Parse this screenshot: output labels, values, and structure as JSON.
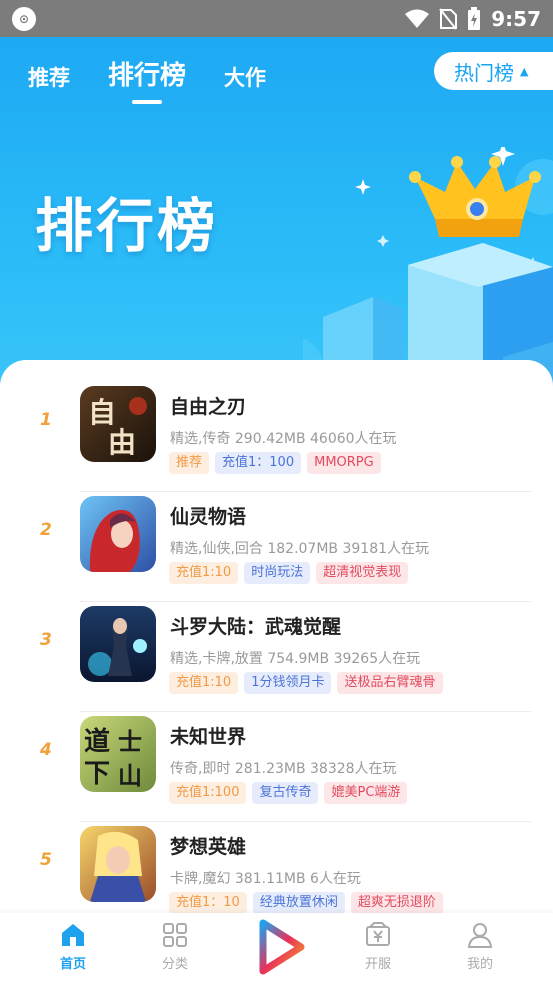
{
  "status_bar": {
    "time": "9:57"
  },
  "header": {
    "tabs": [
      {
        "label": "推荐"
      },
      {
        "label": "排行榜"
      },
      {
        "label": "大作"
      }
    ],
    "hot_button": "热门榜"
  },
  "hero": {
    "title": "排行榜"
  },
  "games": [
    {
      "rank": "1",
      "name": "自由之刃",
      "meta": "精选,传奇 290.42MB 46060人在玩",
      "tags": [
        {
          "text": "推荐",
          "color": "orange"
        },
        {
          "text": "充值1：100",
          "color": "blue"
        },
        {
          "text": "MMORPG",
          "color": "red"
        }
      ]
    },
    {
      "rank": "2",
      "name": "仙灵物语",
      "meta": "精选,仙侠,回合 182.07MB 39181人在玩",
      "tags": [
        {
          "text": "充值1:10",
          "color": "orange"
        },
        {
          "text": "时尚玩法",
          "color": "blue"
        },
        {
          "text": "超清视觉表现",
          "color": "red"
        }
      ]
    },
    {
      "rank": "3",
      "name": "斗罗大陆：武魂觉醒",
      "meta": "精选,卡牌,放置 754.9MB 39265人在玩",
      "tags": [
        {
          "text": "充值1:10",
          "color": "orange"
        },
        {
          "text": "1分钱领月卡",
          "color": "blue"
        },
        {
          "text": "送极品右臂魂骨",
          "color": "red"
        }
      ]
    },
    {
      "rank": "4",
      "name": "未知世界",
      "meta": "传奇,即时 281.23MB 38328人在玩",
      "tags": [
        {
          "text": "充值1:100",
          "color": "orange"
        },
        {
          "text": "复古传奇",
          "color": "blue"
        },
        {
          "text": "媲美PC端游",
          "color": "red"
        }
      ]
    },
    {
      "rank": "5",
      "name": "梦想英雄",
      "meta": "卡牌,魔幻 381.11MB 6人在玩",
      "tags": [
        {
          "text": "充值1：10",
          "color": "orange"
        },
        {
          "text": "经典放置休闲",
          "color": "blue"
        },
        {
          "text": "超爽无损退阶",
          "color": "red"
        }
      ]
    }
  ],
  "bottom_nav": [
    {
      "label": "首页",
      "icon": "home-icon",
      "active": true
    },
    {
      "label": "分类",
      "icon": "grid-icon",
      "active": false
    },
    {
      "label": "",
      "icon": "play-logo-icon",
      "active": false
    },
    {
      "label": "开服",
      "icon": "yen-box-icon",
      "active": false
    },
    {
      "label": "我的",
      "icon": "user-icon",
      "active": false
    }
  ],
  "colors": {
    "brand_blue": "#1ea9f3",
    "rank_orange": "#f0a13a",
    "nav_active": "#1ea2ee"
  }
}
